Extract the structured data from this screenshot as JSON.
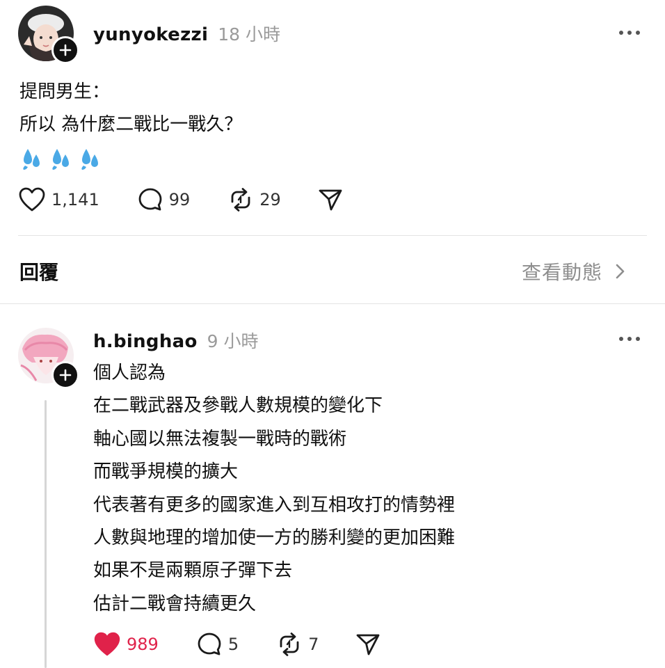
{
  "post": {
    "username": "yunyokezzi",
    "timestamp": "18 小時",
    "lines": [
      "提問男生：",
      "所以 為什麼二戰比一戰久？"
    ],
    "emoji": "💦💦💦",
    "likes": "1,141",
    "comments": "99",
    "reposts": "29"
  },
  "replies_section": {
    "title": "回覆",
    "activity_label": "查看動態"
  },
  "reply": {
    "username": "h.binghao",
    "timestamp": "9 小時",
    "lines": [
      "個人認為",
      "在二戰武器及參戰人數規模的變化下",
      "軸心國以無法複製一戰時的戰術",
      "而戰爭規模的擴大",
      "代表著有更多的國家進入到互相攻打的情勢裡",
      "人數與地理的增加使一方的勝利變的更加困難",
      "如果不是兩顆原子彈下去",
      "估計二戰會持續更久"
    ],
    "likes": "989",
    "liked": true,
    "comments": "5",
    "reposts": "7"
  },
  "colors": {
    "like_active": "#e0224a",
    "muted_text": "#9a9a9a",
    "divider": "#e3e3e3"
  }
}
